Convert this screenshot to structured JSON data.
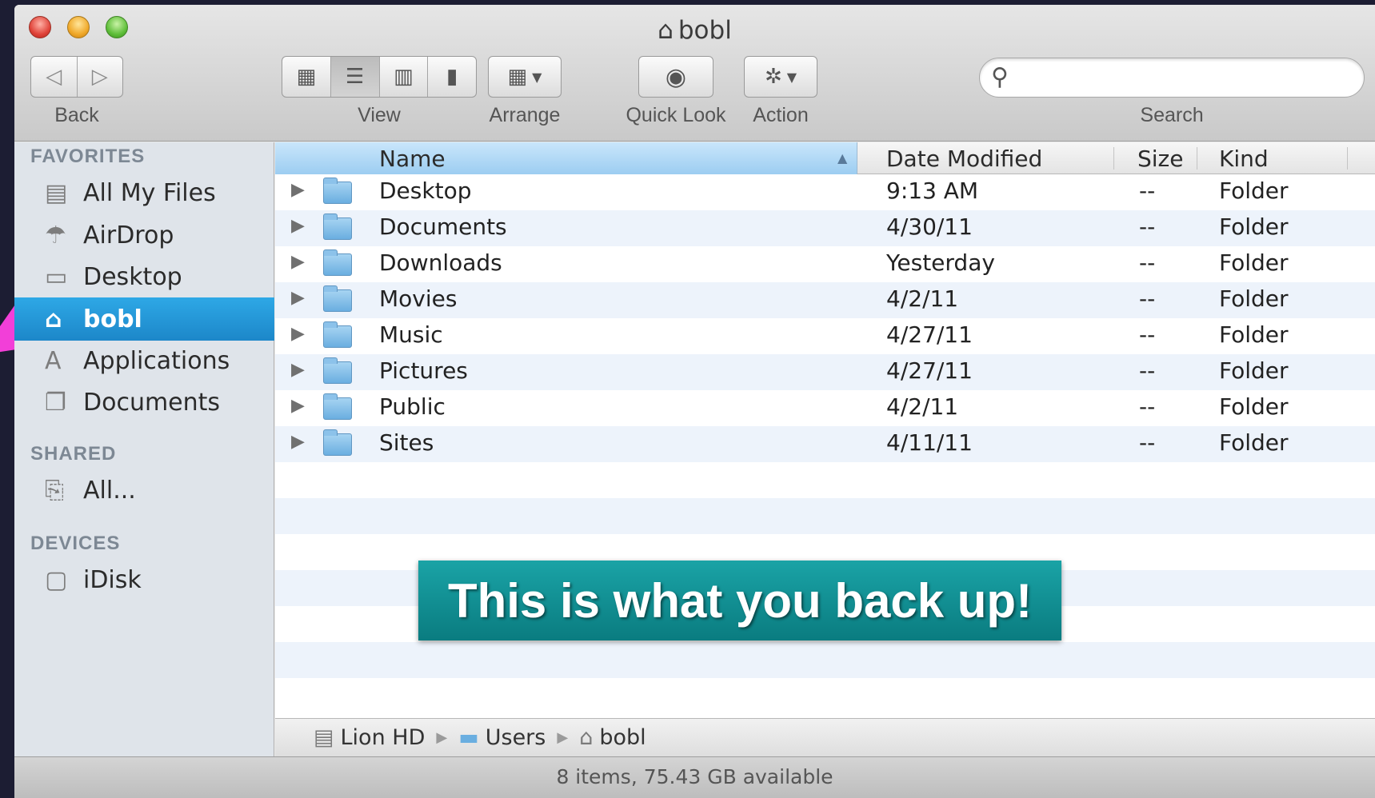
{
  "window": {
    "title": "bobl"
  },
  "toolbar": {
    "back_label": "Back",
    "view_label": "View",
    "arrange_label": "Arrange",
    "quicklook_label": "Quick Look",
    "action_label": "Action",
    "search_label": "Search",
    "search_placeholder": ""
  },
  "sidebar": {
    "favorites_header": "FAVORITES",
    "favorites": [
      {
        "label": "All My Files",
        "icon": "all-files-icon"
      },
      {
        "label": "AirDrop",
        "icon": "airdrop-icon"
      },
      {
        "label": "Desktop",
        "icon": "desktop-icon"
      },
      {
        "label": "bobl",
        "icon": "home-icon",
        "selected": true
      },
      {
        "label": "Applications",
        "icon": "applications-icon"
      },
      {
        "label": "Documents",
        "icon": "documents-icon"
      }
    ],
    "shared_header": "SHARED",
    "shared": [
      {
        "label": "All...",
        "icon": "network-icon"
      }
    ],
    "devices_header": "DEVICES",
    "devices": [
      {
        "label": "iDisk",
        "icon": "idisk-icon"
      }
    ]
  },
  "columns": {
    "name": "Name",
    "date": "Date Modified",
    "size": "Size",
    "kind": "Kind"
  },
  "files": [
    {
      "name": "Desktop",
      "date": "9:13 AM",
      "size": "--",
      "kind": "Folder"
    },
    {
      "name": "Documents",
      "date": "4/30/11",
      "size": "--",
      "kind": "Folder"
    },
    {
      "name": "Downloads",
      "date": "Yesterday",
      "size": "--",
      "kind": "Folder"
    },
    {
      "name": "Movies",
      "date": "4/2/11",
      "size": "--",
      "kind": "Folder"
    },
    {
      "name": "Music",
      "date": "4/27/11",
      "size": "--",
      "kind": "Folder"
    },
    {
      "name": "Pictures",
      "date": "4/27/11",
      "size": "--",
      "kind": "Folder"
    },
    {
      "name": "Public",
      "date": "4/2/11",
      "size": "--",
      "kind": "Folder"
    },
    {
      "name": "Sites",
      "date": "4/11/11",
      "size": "--",
      "kind": "Folder"
    }
  ],
  "callout": {
    "text": "This is what you back up!",
    "color": "#0f8f93"
  },
  "pathbar": {
    "items": [
      "Lion HD",
      "Users",
      "bobl"
    ]
  },
  "statusbar": {
    "text": "8 items, 75.43 GB available"
  },
  "colors": {
    "selection": "#1c87c9",
    "pointer": "#f23fd8"
  }
}
